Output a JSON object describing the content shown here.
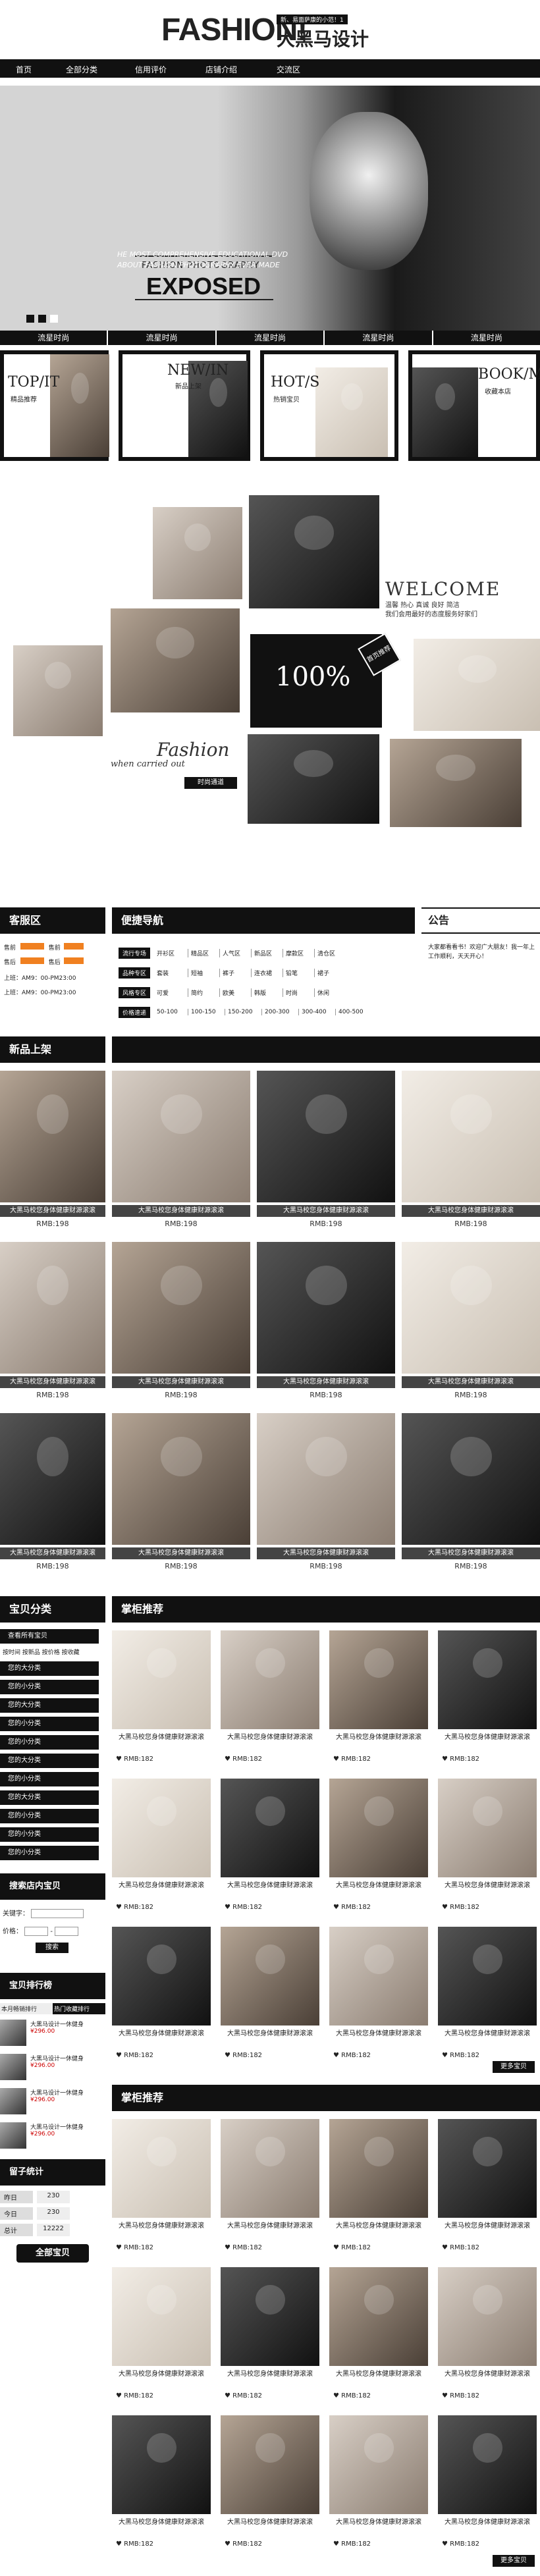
{
  "header": {
    "logo": "FASHION!",
    "tagline": "新、易面萨康的小范！1",
    "shop_name": "大黑马设计"
  },
  "nav": [
    "首页",
    "全部分类",
    "信用评价",
    "店铺介绍",
    "交流区"
  ],
  "banner": {
    "subtitle": "FASHION PHOTOGRAPHY",
    "title": "EXPOSED",
    "desc1": "HE MOST COMPREHENSIVE EDUCATIONAL DVD",
    "desc2": "ABOUT FASHION PHOTOGRAPHY EVER MADE",
    "tabs": [
      "流星时尚",
      "流星时尚",
      "流星时尚",
      "流星时尚",
      "流星时尚"
    ]
  },
  "promo": [
    {
      "label": "TOP/IT",
      "sub": "精品推荐"
    },
    {
      "label": "NEW/IN",
      "sub": "新品上架"
    },
    {
      "label": "HOT/S",
      "sub": "热销宝贝"
    },
    {
      "label": "BOOK/M",
      "sub": "收藏本店"
    }
  ],
  "collage": {
    "welcome": "WELCOME",
    "welcome_text1": "温馨 热心 真诚 良好 简洁",
    "welcome_text2": "我们会用最好的态度服务好家们",
    "percent": "100%",
    "stamp": "首页推荐",
    "fashion": "Fashion",
    "carried": "when carried out",
    "time_btn": "时尚通道"
  },
  "service": {
    "title": "客服区",
    "rows": [
      {
        "a": "售前",
        "b": "售前"
      },
      {
        "a": "售后",
        "b": "售后"
      }
    ],
    "hours1": "上班：AM9：00-PM23:00",
    "hours2": "上班：AM9：00-PM23:00"
  },
  "guide": {
    "title": "便捷导航",
    "rows": [
      {
        "label": "流行专场",
        "items": [
          "开衫区",
          "精品区",
          "人气区",
          "新品区",
          "摩款区",
          "清仓区"
        ]
      },
      {
        "label": "品种专区",
        "items": [
          "套装",
          "短袖",
          "裤子",
          "连衣裙",
          "铅笔",
          "裙子"
        ]
      },
      {
        "label": "风格专区",
        "items": [
          "可爱",
          "简约",
          "欧美",
          "韩版",
          "时尚",
          "休闲"
        ]
      },
      {
        "label": "价格速递",
        "items": [
          "50-100",
          "100-150",
          "150-200",
          "200-300",
          "300-400",
          "400-500"
        ]
      }
    ]
  },
  "notice": {
    "title": "公告",
    "text": "大家都看看书！欢迎广大朋友！我一年上工作顺利，天天开心！"
  },
  "new": {
    "title": "新品上架",
    "caption": "大黑马校您身体健康财源滚滚",
    "price": "RMB:198"
  },
  "sidebar": {
    "cat_title": "宝贝分类",
    "cat_top": "查看所有宝贝",
    "cat_sub": "按时间 按新品 按价格 按收藏",
    "cats": [
      "您的大分类",
      "您的小分类",
      "您的大分类",
      "您的小分类",
      "您的小分类",
      "您的大分类",
      "您的小分类",
      "您的大分类",
      "您的小分类",
      "您的小分类",
      "您的小分类"
    ],
    "search_title": "搜索店内宝贝",
    "kw_label": "关键字：",
    "price_label": "价格：",
    "search_btn": "搜索",
    "rank_title": "宝贝排行榜",
    "rank_tabs": [
      "本月畅销排行",
      "热门收藏排行"
    ],
    "rank_name": "大黑马设计一休健身",
    "rank_price": "¥296.00",
    "stat_title": "留子统计",
    "stats": [
      {
        "k": "昨日",
        "v": "230"
      },
      {
        "k": "今日",
        "v": "230"
      },
      {
        "k": "总计",
        "v": "12222"
      }
    ],
    "all_btn": "全部宝贝"
  },
  "rec": {
    "title": "掌柜推荐",
    "name": "大黑马校您身体健康财源滚滚",
    "price": "RMB:182",
    "more": "更多宝贝"
  }
}
